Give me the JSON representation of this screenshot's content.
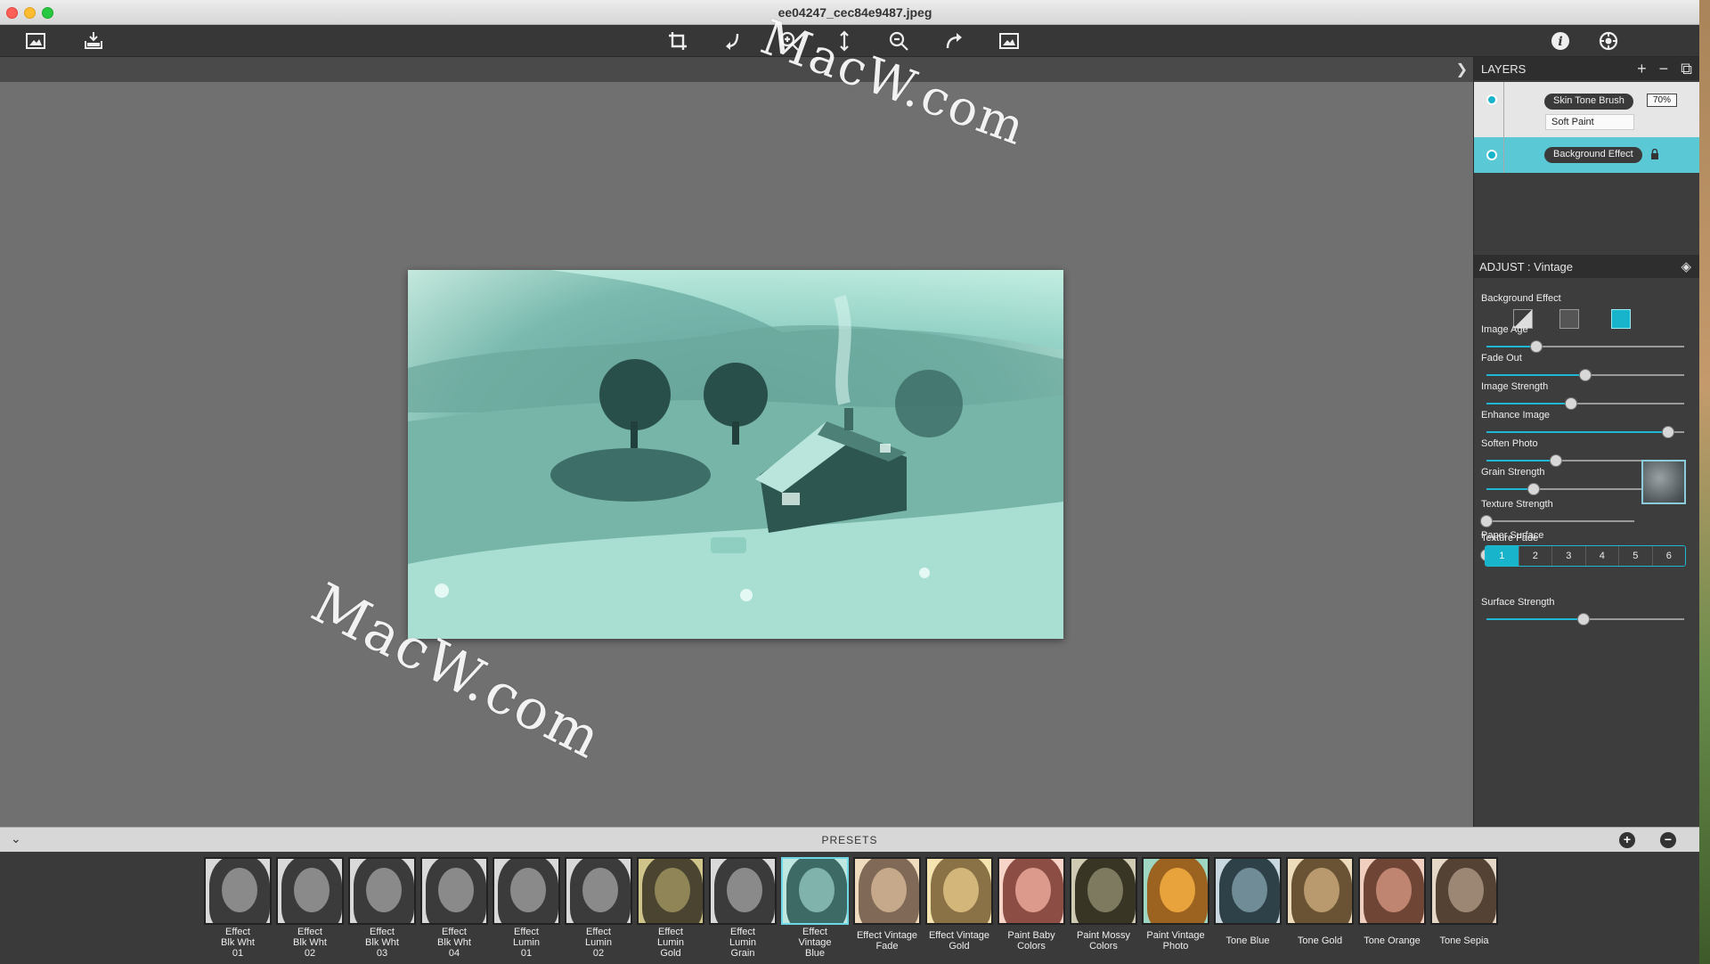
{
  "window": {
    "title": "ee04247_cec84e9487.jpeg"
  },
  "toolbar": {
    "left": [
      "open-image-icon",
      "export-icon"
    ],
    "center": [
      "crop-icon",
      "undo-icon",
      "zoom-in-icon",
      "zoom-fit-icon",
      "zoom-out-icon",
      "redo-icon",
      "compare-icon"
    ],
    "right": [
      "info-icon",
      "settings-icon"
    ]
  },
  "layers": {
    "title": "LAYERS",
    "items": [
      {
        "name": "Skin Tone Brush",
        "opacity": "70%",
        "blend": "Soft Paint",
        "selected": false
      },
      {
        "name": "Background Effect",
        "locked": true,
        "selected": true
      }
    ]
  },
  "adjust": {
    "title": "ADJUST : Vintage",
    "background_effect_label": "Background Effect",
    "sliders": [
      {
        "label": "Image Age",
        "value": 0.25
      },
      {
        "label": "Fade Out",
        "value": 0.5
      },
      {
        "label": "Image Strength",
        "value": 0.43
      },
      {
        "label": "Enhance Image",
        "value": 0.92
      },
      {
        "label": "Soften Photo",
        "value": 0.35
      },
      {
        "label": "Grain Strength",
        "value": 0.24
      },
      {
        "label": "Texture Strength",
        "value": 0.0
      },
      {
        "label": "Texture Fade",
        "value": 0.0
      },
      {
        "label": "Surface Strength",
        "value": 0.49
      }
    ],
    "paper_surface": {
      "label": "Paper Surface",
      "options": [
        "1",
        "2",
        "3",
        "4",
        "5",
        "6"
      ],
      "selected": "1"
    }
  },
  "presets": {
    "title": "PRESETS",
    "items": [
      {
        "label": [
          "Effect",
          "Blk Wht",
          "01"
        ],
        "tone": "bw"
      },
      {
        "label": [
          "Effect",
          "Blk Wht",
          "02"
        ],
        "tone": "bw"
      },
      {
        "label": [
          "Effect",
          "Blk Wht",
          "03"
        ],
        "tone": "bw"
      },
      {
        "label": [
          "Effect",
          "Blk Wht",
          "04"
        ],
        "tone": "bw"
      },
      {
        "label": [
          "Effect",
          "Lumin",
          "01"
        ],
        "tone": "bw"
      },
      {
        "label": [
          "Effect",
          "Lumin",
          "02"
        ],
        "tone": "bw"
      },
      {
        "label": [
          "Effect",
          "Lumin",
          "Gold"
        ],
        "tone": "gold"
      },
      {
        "label": [
          "Effect",
          "Lumin",
          "Grain"
        ],
        "tone": "bw"
      },
      {
        "label": [
          "Effect",
          "Vintage",
          "Blue"
        ],
        "tone": "teal",
        "selected": true
      },
      {
        "label": [
          "Effect Vintage",
          "Fade"
        ],
        "tone": "fade"
      },
      {
        "label": [
          "Effect Vintage",
          "Gold"
        ],
        "tone": "goldlight"
      },
      {
        "label": [
          "Paint Baby",
          "Colors"
        ],
        "tone": "pink"
      },
      {
        "label": [
          "Paint Mossy",
          "Colors"
        ],
        "tone": "moss"
      },
      {
        "label": [
          "Paint Vintage",
          "Photo"
        ],
        "tone": "vintagephoto"
      },
      {
        "label": [
          "Tone Blue"
        ],
        "tone": "blue"
      },
      {
        "label": [
          "Tone Gold"
        ],
        "tone": "tonegold"
      },
      {
        "label": [
          "Tone Orange"
        ],
        "tone": "orange"
      },
      {
        "label": [
          "Tone Sepia"
        ],
        "tone": "sepia"
      }
    ]
  },
  "watermarks": [
    "MacW.com",
    "MacW.com",
    "MacW.c"
  ]
}
